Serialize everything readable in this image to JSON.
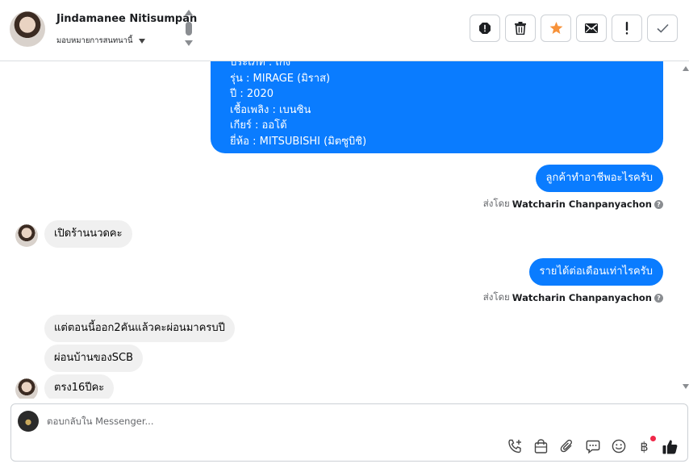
{
  "header": {
    "contact_name": "Jindamanee Nitisumpan",
    "assign_label": "มอบหมายการสนทนานี้",
    "actions": [
      {
        "name": "report-icon"
      },
      {
        "name": "trash-icon"
      },
      {
        "name": "star-icon",
        "color": "#f7923a"
      },
      {
        "name": "envelope-icon"
      },
      {
        "name": "exclamation-icon"
      },
      {
        "name": "check-icon"
      }
    ]
  },
  "messages": {
    "car_details": {
      "type_line": "ประเภท : เก๋ง",
      "model_line": "รุ่น : MIRAGE (มิราส)",
      "year_line": "ปี : 2020",
      "fuel_line": "เชื้อเพลิง : เบนซิน",
      "gear_line": "เกียร์ : ออโต้",
      "brand_line": "ยี่ห้อ : MITSUBISHI (มิตซูบิชิ)"
    },
    "out_1": "ลูกค้าทำอาชีพอะไรครับ",
    "sent_by_1": {
      "prefix": "ส่งโดย",
      "name": "Watcharin Chanpanyachon"
    },
    "in_1": "เปิดร้านนวดคะ",
    "out_2": "รายได้ต่อเดือนเท่าไรครับ",
    "sent_by_2": {
      "prefix": "ส่งโดย",
      "name": "Watcharin Chanpanyachon"
    },
    "in_2": "แต่ตอนนี้ออก2คันแล้วคะผ่อนมาครบปี",
    "in_3": "ผ่อนบ้านของSCB",
    "in_4": "ตรง16ปีคะ"
  },
  "composer": {
    "placeholder": "ตอบกลับใน Messenger...",
    "tools": [
      "phone-plus-icon",
      "shopping-bag-icon",
      "paperclip-icon",
      "chat-bubble-icon",
      "smiley-icon",
      "baht-icon",
      "thumbs-up-icon"
    ],
    "baht_symbol": "฿"
  },
  "colors": {
    "outgoing_bubble": "#0a7cff",
    "incoming_bubble": "#f0f0f0",
    "accent_star": "#f7923a",
    "notification_dot": "#f02849"
  }
}
